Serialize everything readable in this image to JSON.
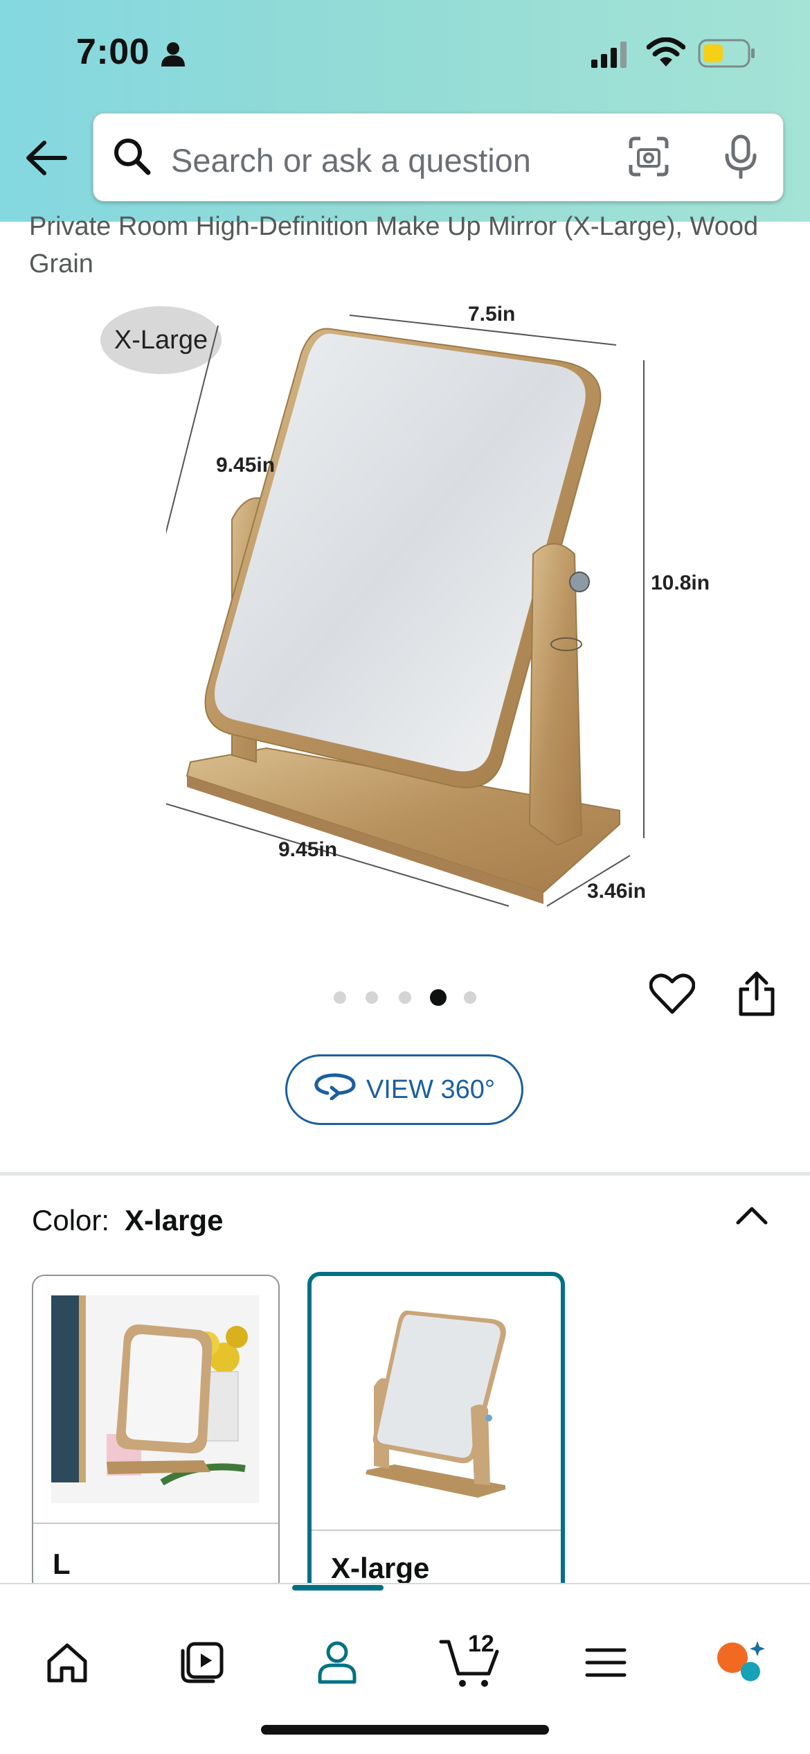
{
  "status_bar": {
    "time": "7:00"
  },
  "search": {
    "placeholder": "Search or ask a question"
  },
  "product": {
    "title_partial": "Private Room High-Definition Make Up Mirror (X-Large), Wood Grain",
    "size_badge": "X-Large",
    "dimensions": {
      "top_width": "7.5in",
      "left_height": "9.45in",
      "right_height": "10.8in",
      "base_width": "9.45in",
      "base_depth": "3.46in"
    },
    "image_dots": {
      "count": 5,
      "active_index": 3
    }
  },
  "view360": {
    "label": "VIEW 360°"
  },
  "color_selector": {
    "label": "Color:",
    "selected": "X-large",
    "options": [
      {
        "label": "L",
        "selected": false
      },
      {
        "label": "X-large",
        "selected": true
      }
    ]
  },
  "bottom_nav": {
    "items": [
      "home",
      "video",
      "account",
      "cart",
      "menu",
      "rufus"
    ],
    "cart_count": "12",
    "active": "account"
  },
  "colors": {
    "accent": "#007185",
    "link": "#1a5f9f",
    "header_gradient_start": "#84d8e0",
    "header_gradient_end": "#a4e3d6"
  }
}
